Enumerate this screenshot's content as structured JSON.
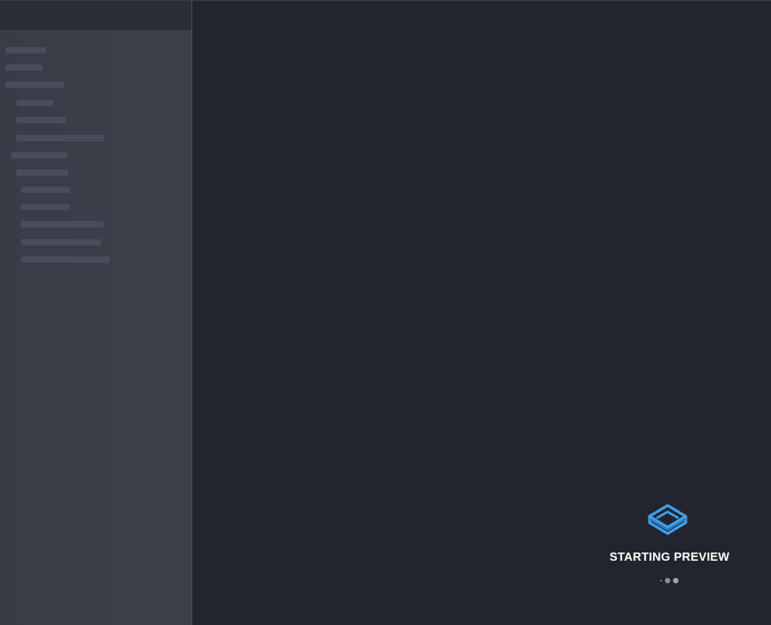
{
  "preview": {
    "status_text": "STARTING PREVIEW",
    "icon": "layers-icon",
    "accent_color": "#3ea2f0"
  },
  "sidebar": {
    "state": "loading-skeleton",
    "skeleton_rows": 13
  },
  "colors": {
    "background": "#23252e",
    "sidebar": "#3b3e49",
    "skeleton": "#4a4d59"
  }
}
